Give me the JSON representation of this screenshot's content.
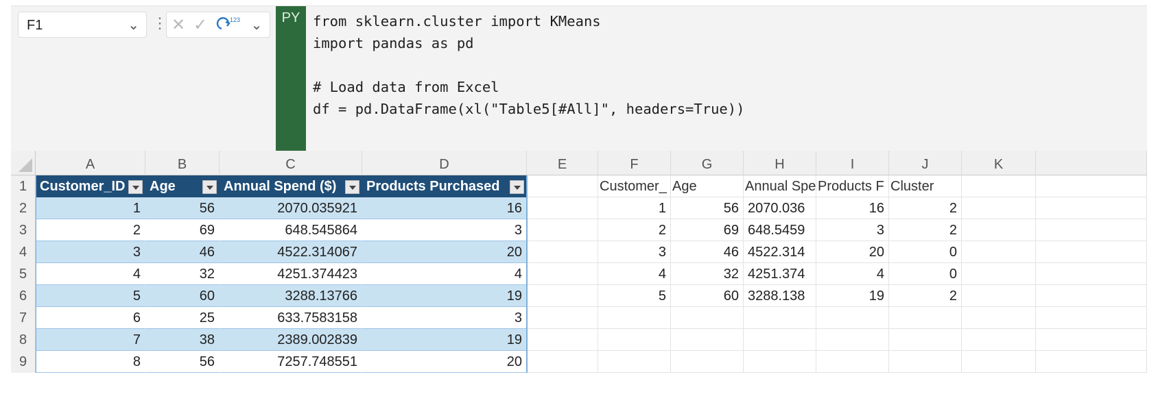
{
  "formula_bar": {
    "name_box": "F1",
    "python_badge": "PY",
    "code_lines": [
      "from sklearn.cluster import KMeans",
      "import pandas as pd",
      "",
      "# Load data from Excel",
      "df = pd.DataFrame(xl(\"Table5[#All]\", headers=True))"
    ],
    "icons": [
      "chevron-down-icon",
      "more-vertical-icon",
      "cancel-icon",
      "enter-icon",
      "python-output-icon",
      "chevron-down-icon"
    ]
  },
  "grid": {
    "columns": [
      "A",
      "B",
      "C",
      "D",
      "E",
      "F",
      "G",
      "H",
      "I",
      "J",
      "K"
    ],
    "rows": [
      "1",
      "2",
      "3",
      "4",
      "5",
      "6",
      "7",
      "8",
      "9"
    ],
    "table": {
      "headers": [
        "Customer_ID",
        "Age",
        "Annual Spend ($)",
        "Products Purchased"
      ],
      "rows": [
        [
          "1",
          "56",
          "2070.035921",
          "16"
        ],
        [
          "2",
          "69",
          "648.545864",
          "3"
        ],
        [
          "3",
          "46",
          "4522.314067",
          "20"
        ],
        [
          "4",
          "32",
          "4251.374423",
          "4"
        ],
        [
          "5",
          "60",
          "3288.13766",
          "19"
        ],
        [
          "6",
          "25",
          "633.7583158",
          "3"
        ],
        [
          "7",
          "38",
          "2389.002839",
          "19"
        ],
        [
          "8",
          "56",
          "7257.748551",
          "20"
        ]
      ]
    },
    "output": {
      "headers": [
        "Customer_",
        "Age",
        "Annual Spe",
        "Products F",
        "Cluster"
      ],
      "rows": [
        [
          "1",
          "56",
          "2070.036",
          "16",
          "2"
        ],
        [
          "2",
          "69",
          "648.5459",
          "3",
          "2"
        ],
        [
          "3",
          "46",
          "4522.314",
          "20",
          "0"
        ],
        [
          "4",
          "32",
          "4251.374",
          "4",
          "0"
        ],
        [
          "5",
          "60",
          "3288.138",
          "19",
          "2"
        ]
      ]
    }
  }
}
